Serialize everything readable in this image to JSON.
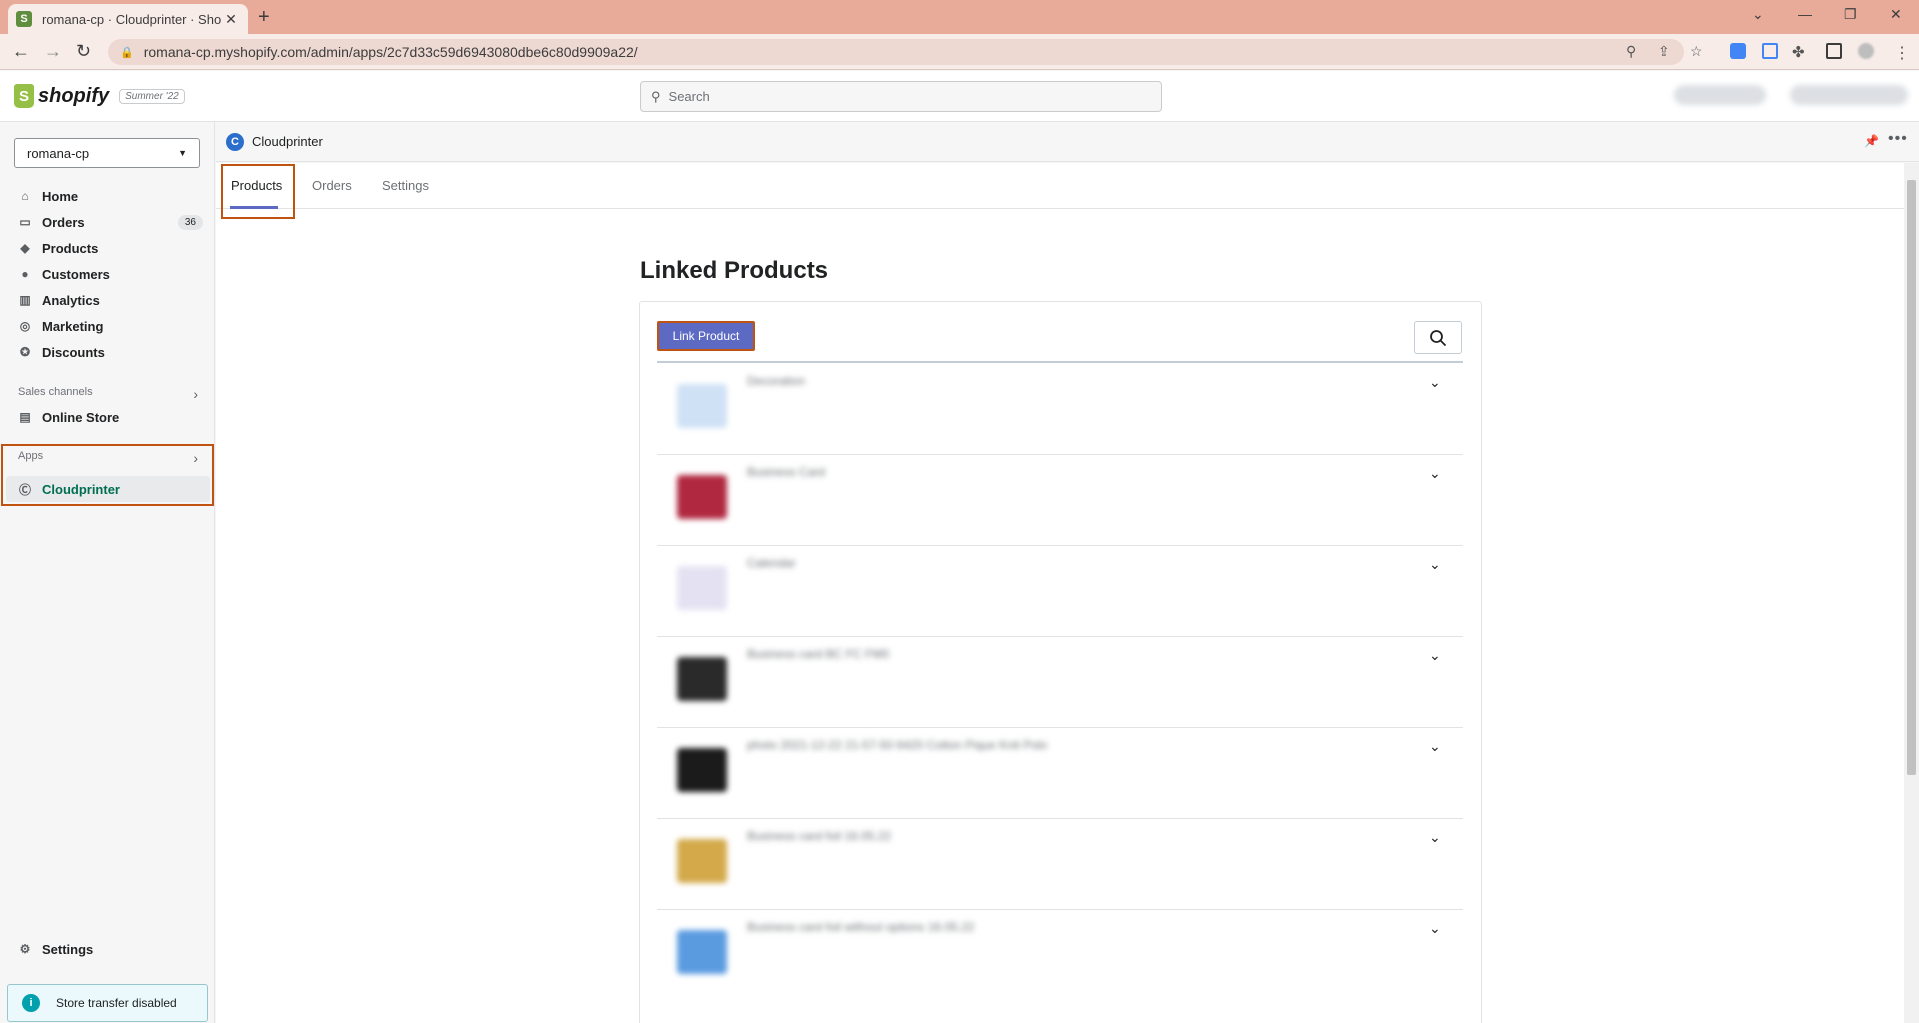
{
  "browser": {
    "tab_title": "romana-cp · Cloudprinter · Shopi",
    "tab_close": "✕",
    "new_tab": "+",
    "url": "romana-cp.myshopify.com/admin/apps/2c7d33c59d6943080dbe6c80d9909a22/"
  },
  "topbar": {
    "logo_text": "shopify",
    "edition": "Summer '22",
    "search_placeholder": "Search"
  },
  "sidebar": {
    "store_name": "romana-cp",
    "items": [
      {
        "label": "Home",
        "icon": "home-icon"
      },
      {
        "label": "Orders",
        "icon": "orders-icon",
        "badge": "36"
      },
      {
        "label": "Products",
        "icon": "tag-icon"
      },
      {
        "label": "Customers",
        "icon": "person-icon"
      },
      {
        "label": "Analytics",
        "icon": "bar-chart-icon"
      },
      {
        "label": "Marketing",
        "icon": "target-icon"
      },
      {
        "label": "Discounts",
        "icon": "discount-icon"
      }
    ],
    "sales_channels_label": "Sales channels",
    "online_store_label": "Online Store",
    "apps_label": "Apps",
    "cloudprinter_label": "Cloudprinter",
    "settings_label": "Settings",
    "store_transfer_label": "Store transfer disabled"
  },
  "app": {
    "name": "Cloudprinter",
    "tabs": [
      "Products",
      "Orders",
      "Settings"
    ],
    "page_title": "Linked Products",
    "link_button": "Link Product",
    "products": [
      {
        "name": "Decoration",
        "thumb_color": "#cfe1f5"
      },
      {
        "name": "Business Card",
        "thumb_color": "#b0283f"
      },
      {
        "name": "Calendar",
        "thumb_color": "#e4e2f2"
      },
      {
        "name": "Business card BC FC FM0",
        "thumb_color": "#2a2a2a"
      },
      {
        "name": "photo 2021-12-22 21-57-50 6420 Cotton Pique Knit Polo",
        "thumb_color": "#1b1b1b"
      },
      {
        "name": "Business card foil 16.05.22",
        "thumb_color": "#d3a94a"
      },
      {
        "name": "Business card foil without options 16.05.22",
        "thumb_color": "#5a9be0"
      }
    ]
  },
  "colors": {
    "primary": "#5c6ac4",
    "highlight": "#c0530f",
    "active_link": "#006e52"
  }
}
